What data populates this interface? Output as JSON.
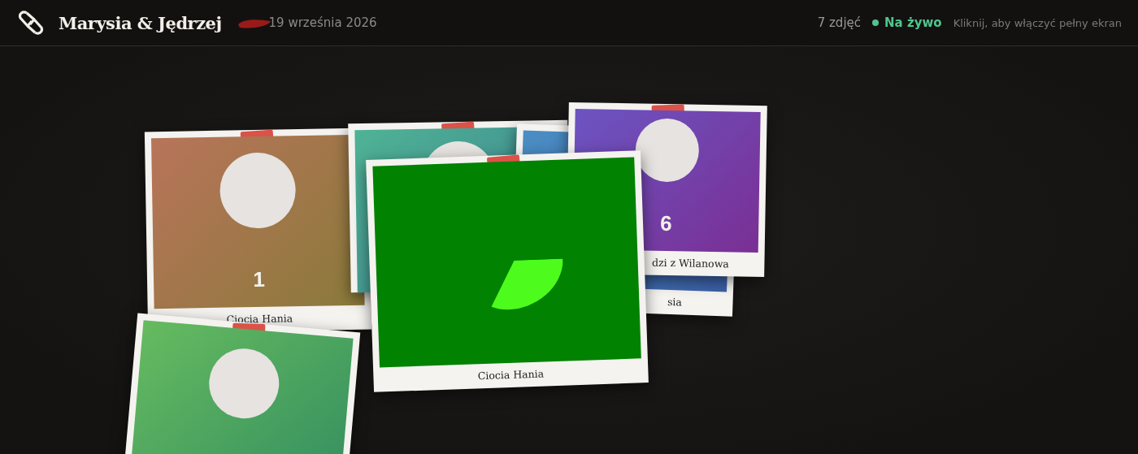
{
  "header": {
    "title": "Marysia & Jędrzej",
    "date": "19 września 2026",
    "photo_count": "7 zdjęć",
    "live": {
      "label": "Na żywo",
      "on": true
    },
    "hint": "Kliknij, aby włączyć pełny ekran"
  },
  "photos": [
    {
      "kind": "placeholder",
      "number": "1",
      "caption": "Ciocia Hania"
    },
    {
      "kind": "placeholder"
    },
    {
      "kind": "placeholder",
      "caption": "sia"
    },
    {
      "kind": "placeholder",
      "number": "6",
      "caption": "dzi z Wilanowa"
    },
    {
      "kind": "placeholder"
    },
    {
      "kind": "video",
      "caption": "Ciocia Hania"
    }
  ]
}
